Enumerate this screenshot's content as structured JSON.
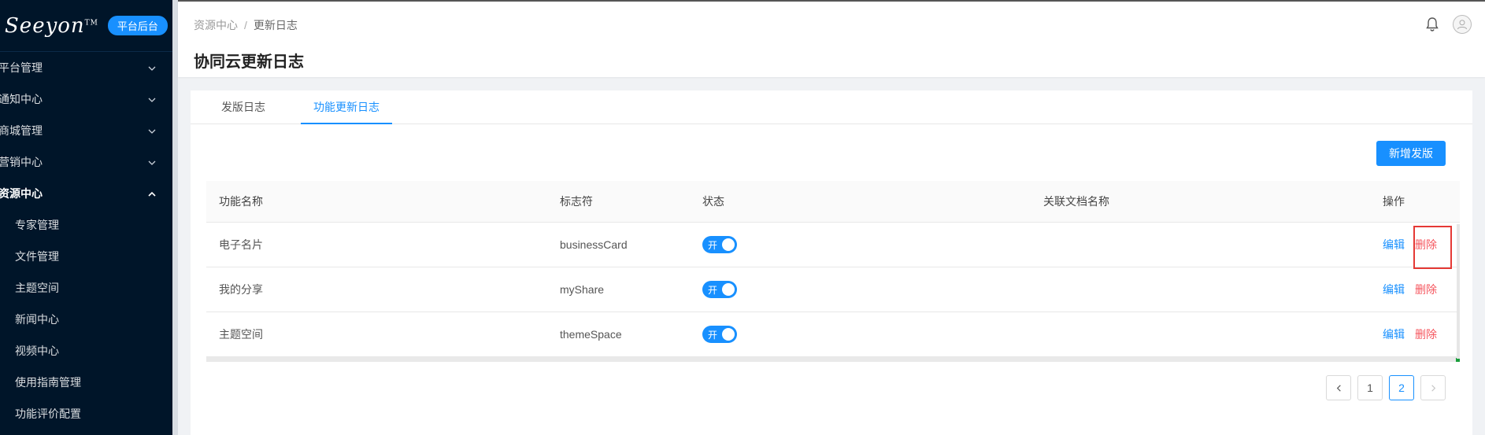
{
  "sidebar": {
    "logo": "Seeyon",
    "logo_tm": "TM",
    "badge": "平台后台",
    "menus": [
      {
        "label": "平台管理"
      },
      {
        "label": "通知中心"
      },
      {
        "label": "商城管理"
      },
      {
        "label": "营销中心"
      },
      {
        "label": "资源中心"
      }
    ],
    "sub_items": [
      {
        "label": "专家管理"
      },
      {
        "label": "文件管理"
      },
      {
        "label": "主题空间"
      },
      {
        "label": "新闻中心"
      },
      {
        "label": "视频中心"
      },
      {
        "label": "使用指南管理"
      },
      {
        "label": "功能评价配置"
      }
    ]
  },
  "header": {
    "breadcrumb": [
      "资源中心",
      "更新日志"
    ],
    "separator": "/",
    "title": "协同云更新日志"
  },
  "tabs": [
    {
      "label": "发版日志"
    },
    {
      "label": "功能更新日志"
    }
  ],
  "toolbar": {
    "new_label": "新增发版"
  },
  "table": {
    "columns": [
      "功能名称",
      "标志符",
      "状态",
      "关联文档名称",
      "操作"
    ],
    "rows": [
      {
        "name": "电子名片",
        "identifier": "businessCard",
        "status": "开",
        "doc": "",
        "edit": "编辑",
        "delete": "删除"
      },
      {
        "name": "我的分享",
        "identifier": "myShare",
        "status": "开",
        "doc": "",
        "edit": "编辑",
        "delete": "删除"
      },
      {
        "name": "主题空间",
        "identifier": "themeSpace",
        "status": "开",
        "doc": "",
        "edit": "编辑",
        "delete": "删除"
      }
    ]
  },
  "pagination": {
    "pages": [
      "1",
      "2"
    ],
    "current": "2",
    "prev": "<",
    "next": ">"
  },
  "colors": {
    "primary": "#1890ff",
    "danger": "#f5555d",
    "sidebar_bg": "#001529",
    "highlight": "#e53935"
  }
}
